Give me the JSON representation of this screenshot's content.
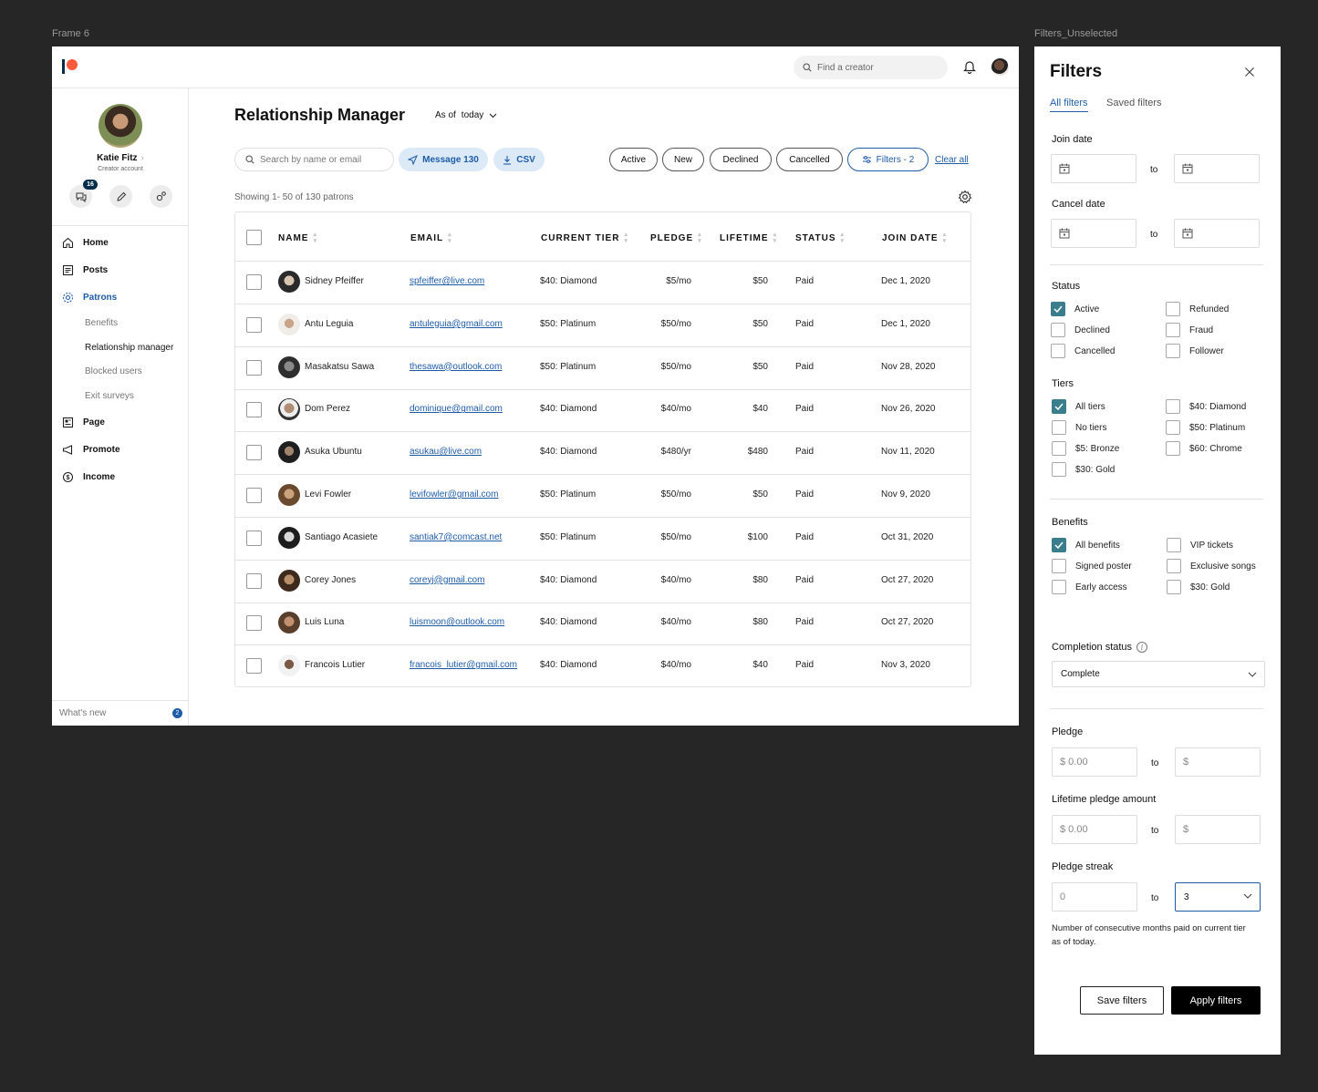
{
  "frame_labels": {
    "main": "Frame 6",
    "filters": "Filters_Unselected"
  },
  "topbar": {
    "search_placeholder": "Find a creator"
  },
  "profile": {
    "name": "Katie Fitz",
    "subtitle": "Creator account",
    "message_badge": "16"
  },
  "nav": {
    "items": [
      {
        "label": "Home",
        "icon": "home-icon"
      },
      {
        "label": "Posts",
        "icon": "posts-icon"
      },
      {
        "label": "Patrons",
        "icon": "patrons-icon",
        "active": true
      },
      {
        "label": "Page",
        "icon": "page-icon"
      },
      {
        "label": "Promote",
        "icon": "megaphone-icon"
      },
      {
        "label": "Income",
        "icon": "dollar-icon"
      }
    ],
    "sub_items": [
      "Benefits",
      "Relationship manager",
      "Blocked users",
      "Exit surveys"
    ],
    "whats_new": "What's new",
    "whats_new_badge": "2"
  },
  "main": {
    "title": "Relationship Manager",
    "as_of": "As of",
    "as_of_value": "today",
    "search_placeholder": "Search by name or email",
    "message_button": "Message 130",
    "csv_button": "CSV",
    "chips": [
      "Active",
      "New",
      "Declined",
      "Cancelled"
    ],
    "filters_button": "Filters - 2",
    "clear_all": "Clear all",
    "showing": "Showing 1- 50 of 130 patrons"
  },
  "table": {
    "headers": [
      "NAME",
      "EMAIL",
      "CURRENT TIER",
      "PLEDGE",
      "LIFETIME",
      "STATUS",
      "JOIN DATE"
    ],
    "rows": [
      {
        "name": "Sidney Pfeiffer",
        "email": "spfeiffer@live.com",
        "tier": "$40: Diamond",
        "pledge": "$5/mo",
        "lifetime": "$50",
        "status": "Paid",
        "join": "Dec 1, 2020"
      },
      {
        "name": "Antu Leguia",
        "email": "antuleguia@gmail.com",
        "tier": "$50: Platinum",
        "pledge": "$50/mo",
        "lifetime": "$50",
        "status": "Paid",
        "join": "Dec 1, 2020"
      },
      {
        "name": "Masakatsu Sawa",
        "email": "thesawa@outlook.com",
        "tier": "$50: Platinum",
        "pledge": "$50/mo",
        "lifetime": "$50",
        "status": "Paid",
        "join": "Nov 28, 2020"
      },
      {
        "name": "Dom Perez",
        "email": "dominique@gmail.com",
        "tier": "$40: Diamond",
        "pledge": "$40/mo",
        "lifetime": "$40",
        "status": "Paid",
        "join": "Nov 26, 2020"
      },
      {
        "name": "Asuka Ubuntu",
        "email": "asukau@live.com",
        "tier": "$40: Diamond",
        "pledge": "$480/yr",
        "lifetime": "$480",
        "status": "Paid",
        "join": "Nov 11, 2020"
      },
      {
        "name": "Levi Fowler",
        "email": "levifowler@gmail.com",
        "tier": "$50: Platinum",
        "pledge": "$50/mo",
        "lifetime": "$50",
        "status": "Paid",
        "join": "Nov 9, 2020"
      },
      {
        "name": "Santiago Acasiete",
        "email": "santiak7@comcast.net",
        "tier": "$50: Platinum",
        "pledge": "$50/mo",
        "lifetime": "$100",
        "status": "Paid",
        "join": "Oct 31, 2020"
      },
      {
        "name": "Corey Jones",
        "email": "coreyj@gmail.com",
        "tier": "$40: Diamond",
        "pledge": "$40/mo",
        "lifetime": "$80",
        "status": "Paid",
        "join": "Oct 27, 2020"
      },
      {
        "name": "Luis Luna",
        "email": "luismoon@outlook.com",
        "tier": "$40: Diamond",
        "pledge": "$40/mo",
        "lifetime": "$80",
        "status": "Paid",
        "join": "Oct 27, 2020"
      },
      {
        "name": "Francois Lutier",
        "email": "francois_lutier@gmail.com",
        "tier": "$40: Diamond",
        "pledge": "$40/mo",
        "lifetime": "$40",
        "status": "Paid",
        "join": "Nov 3, 2020"
      }
    ]
  },
  "filters": {
    "title": "Filters",
    "tabs": {
      "all": "All filters",
      "saved": "Saved filters"
    },
    "join_date": "Join date",
    "cancel_date": "Cancel date",
    "to": "to",
    "status": {
      "label": "Status",
      "options": [
        {
          "label": "Active",
          "checked": true
        },
        {
          "label": "Refunded",
          "checked": false
        },
        {
          "label": "Declined",
          "checked": false
        },
        {
          "label": "Fraud",
          "checked": false
        },
        {
          "label": "Cancelled",
          "checked": false
        },
        {
          "label": "Follower",
          "checked": false
        }
      ]
    },
    "tiers": {
      "label": "Tiers",
      "options": [
        {
          "label": "All tiers",
          "checked": true
        },
        {
          "label": "$40: Diamond",
          "checked": false
        },
        {
          "label": "No tiers",
          "checked": false
        },
        {
          "label": "$50: Platinum",
          "checked": false
        },
        {
          "label": "$5: Bronze",
          "checked": false
        },
        {
          "label": "$60: Chrome",
          "checked": false
        },
        {
          "label": "$30: Gold",
          "checked": false
        }
      ]
    },
    "benefits": {
      "label": "Benefits",
      "options": [
        {
          "label": "All benefits",
          "checked": true
        },
        {
          "label": "VIP tickets",
          "checked": false
        },
        {
          "label": "Signed poster",
          "checked": false
        },
        {
          "label": "Exclusive songs",
          "checked": false
        },
        {
          "label": "Early access",
          "checked": false
        },
        {
          "label": "$30: Gold",
          "checked": false
        }
      ]
    },
    "completion_status": {
      "label": "Completion status",
      "value": "Complete"
    },
    "pledge": {
      "label": "Pledge",
      "min_placeholder": "$ 0.00",
      "max_placeholder": "$"
    },
    "lifetime": {
      "label": "Lifetime pledge amount",
      "min_placeholder": "$ 0.00",
      "max_placeholder": "$"
    },
    "streak": {
      "label": "Pledge streak",
      "min_placeholder": "0",
      "max_value": "3",
      "help": "Number of consecutive months paid on current tier as of today."
    },
    "save_button": "Save filters",
    "apply_button": "Apply filters"
  },
  "colors": {
    "brand_coral": "#ff5a3c",
    "brand_navy": "#052d49",
    "link_blue": "#1f5ca8",
    "check_teal": "#3a7d8c"
  }
}
